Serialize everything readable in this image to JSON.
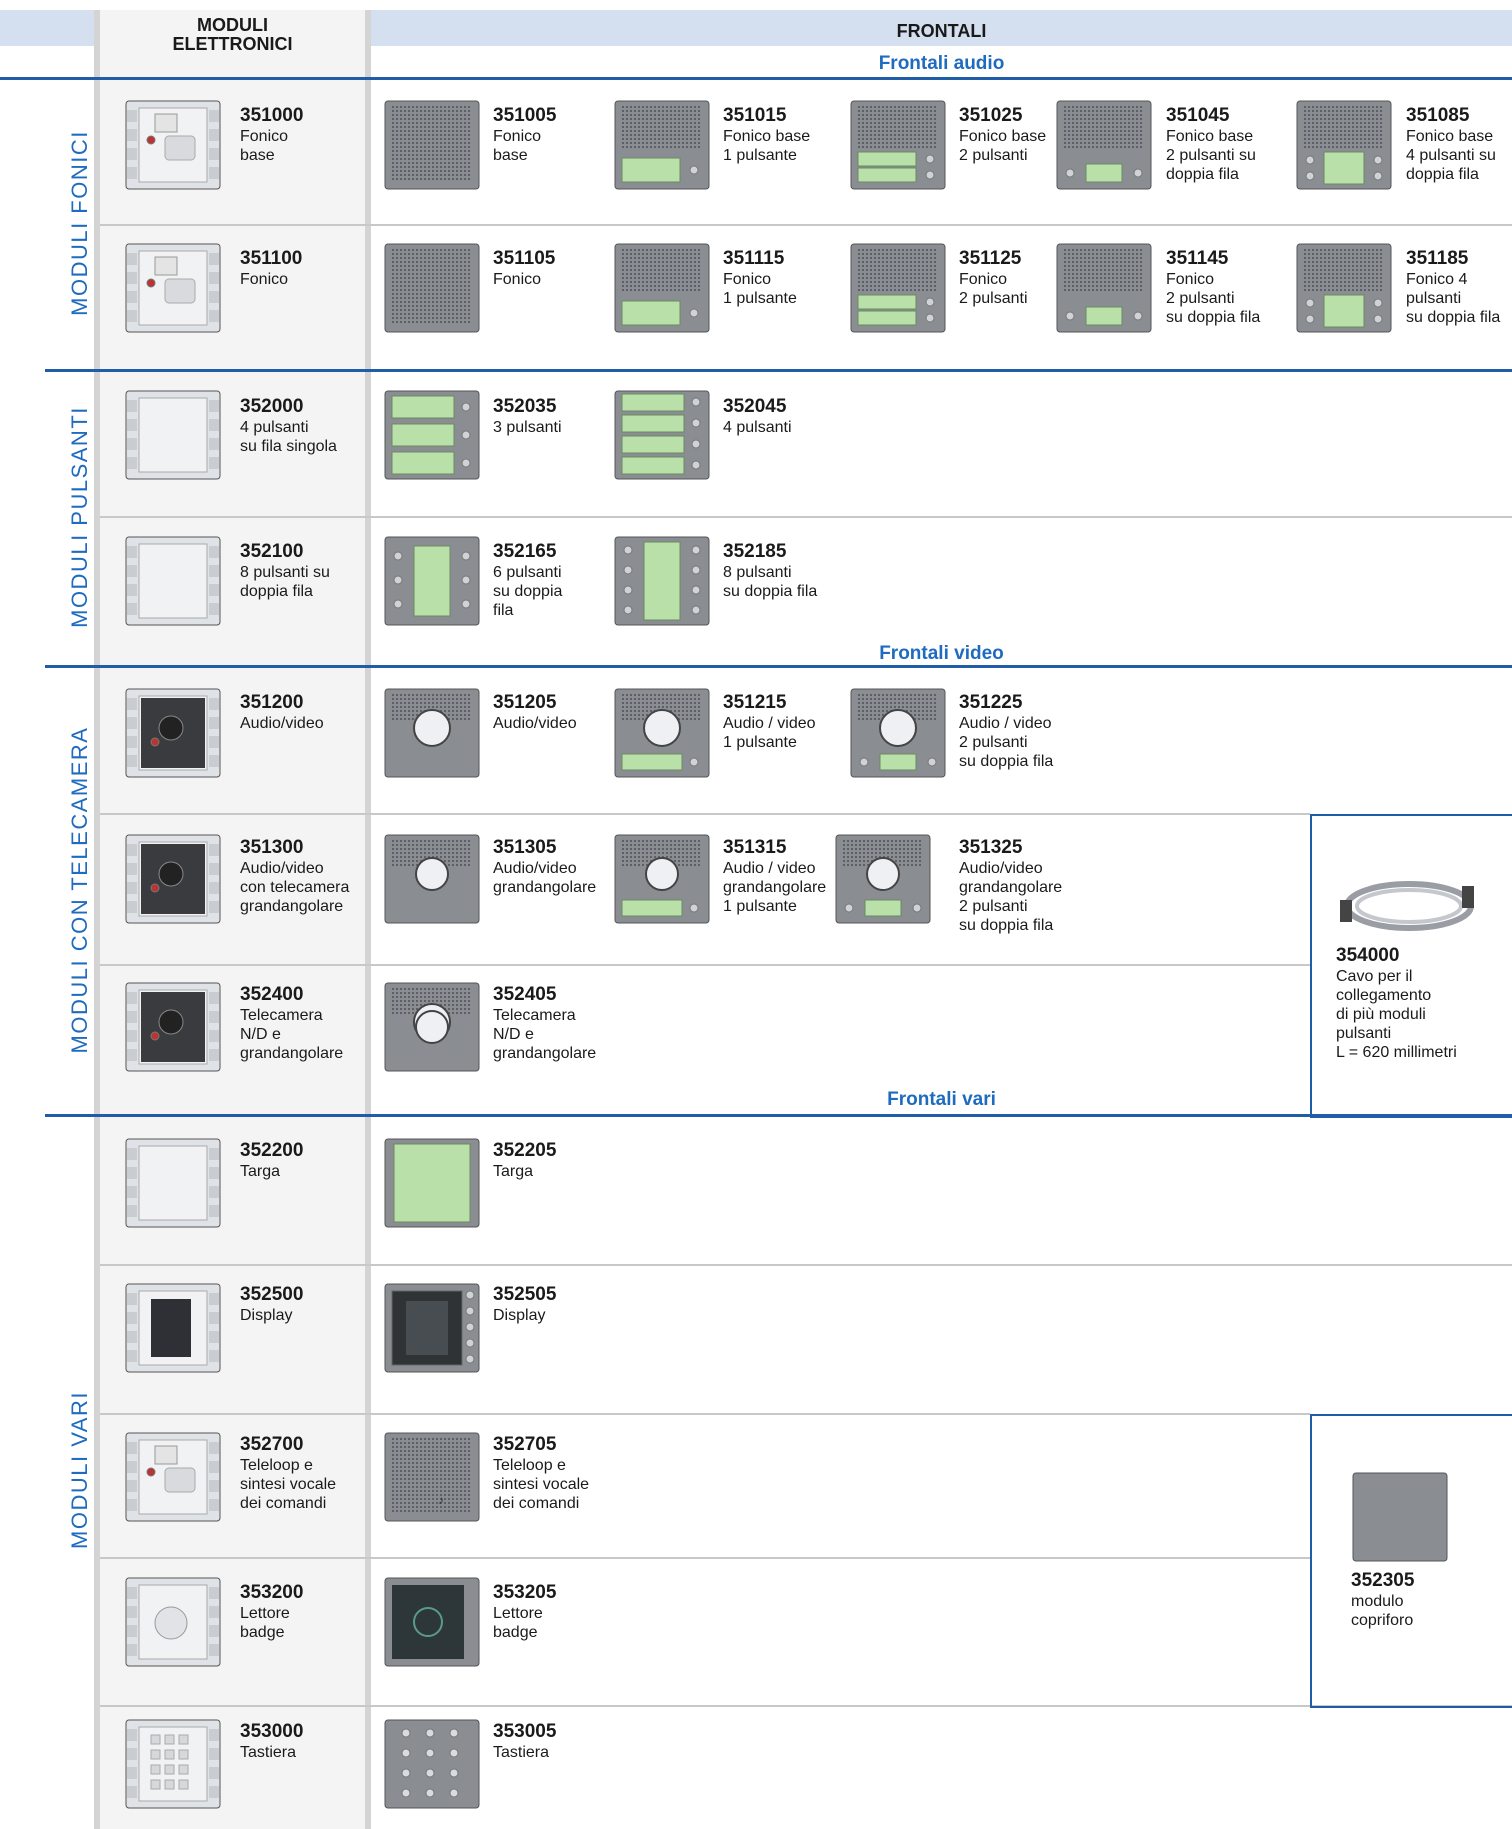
{
  "headers": {
    "moduli_elettronici": "MODULI\nELETTRONICI",
    "frontali": "FRONTALI",
    "frontali_audio": "Frontali audio",
    "frontali_video": "Frontali video",
    "frontali_vari": "Frontali vari"
  },
  "sections": {
    "fonici": "MODULI FONICI",
    "pulsanti": "MODULI PULSANTI",
    "telecamera": "MODULI CON TELECAMERA",
    "vari": "MODULI VARI"
  },
  "items": [
    {
      "code": "351000",
      "desc": "Fonico\nbase"
    },
    {
      "code": "351005",
      "desc": "Fonico\nbase"
    },
    {
      "code": "351015",
      "desc": "Fonico base\n1 pulsante"
    },
    {
      "code": "351025",
      "desc": "Fonico base\n2 pulsanti"
    },
    {
      "code": "351045",
      "desc": "Fonico base\n2 pulsanti su\ndoppia fila"
    },
    {
      "code": "351085",
      "desc": "Fonico base\n4 pulsanti su\ndoppia fila"
    },
    {
      "code": "351100",
      "desc": "Fonico"
    },
    {
      "code": "351105",
      "desc": "Fonico"
    },
    {
      "code": "351115",
      "desc": "Fonico\n1 pulsante"
    },
    {
      "code": "351125",
      "desc": "Fonico\n2 pulsanti"
    },
    {
      "code": "351145",
      "desc": "Fonico\n2 pulsanti\nsu doppia fila"
    },
    {
      "code": "351185",
      "desc": "Fonico 4\npulsanti\nsu doppia fila"
    },
    {
      "code": "352000",
      "desc": "4 pulsanti\nsu fila singola"
    },
    {
      "code": "352035",
      "desc": "3 pulsanti"
    },
    {
      "code": "352045",
      "desc": "4 pulsanti"
    },
    {
      "code": "352100",
      "desc": "8 pulsanti su\ndoppia fila"
    },
    {
      "code": "352165",
      "desc": "6 pulsanti\nsu doppia\nfila"
    },
    {
      "code": "352185",
      "desc": "8 pulsanti\nsu doppia fila"
    },
    {
      "code": "351200",
      "desc": "Audio/video"
    },
    {
      "code": "351205",
      "desc": "Audio/video"
    },
    {
      "code": "351215",
      "desc": "Audio / video\n1 pulsante"
    },
    {
      "code": "351225",
      "desc": "Audio / video\n2 pulsanti\nsu doppia fila"
    },
    {
      "code": "351300",
      "desc": "Audio/video\ncon telecamera\ngrandangolare"
    },
    {
      "code": "351305",
      "desc": "Audio/video\ngrandangolare"
    },
    {
      "code": "351315",
      "desc": "Audio / video\ngrandangolare\n1 pulsante"
    },
    {
      "code": "351325",
      "desc": "Audio/video\ngrandangolare\n2 pulsanti\nsu doppia fila"
    },
    {
      "code": "352400",
      "desc": "Telecamera\nN/D e\ngrandangolare"
    },
    {
      "code": "352405",
      "desc": "Telecamera\nN/D e\ngrandangolare"
    },
    {
      "code": "354000",
      "desc": "Cavo per il\ncollegamento\ndi più moduli\npulsanti\nL = 620 millimetri"
    },
    {
      "code": "352200",
      "desc": "Targa"
    },
    {
      "code": "352205",
      "desc": "Targa"
    },
    {
      "code": "352500",
      "desc": "Display"
    },
    {
      "code": "352505",
      "desc": "Display"
    },
    {
      "code": "352700",
      "desc": "Teleloop e\nsintesi vocale\ndei comandi"
    },
    {
      "code": "352705",
      "desc": "Teleloop e\nsintesi vocale\ndei comandi"
    },
    {
      "code": "353200",
      "desc": "Lettore\nbadge"
    },
    {
      "code": "353205",
      "desc": "Lettore\nbadge"
    },
    {
      "code": "353000",
      "desc": "Tastiera"
    },
    {
      "code": "353005",
      "desc": "Tastiera"
    },
    {
      "code": "352305",
      "desc": "modulo\ncopriforo"
    }
  ]
}
